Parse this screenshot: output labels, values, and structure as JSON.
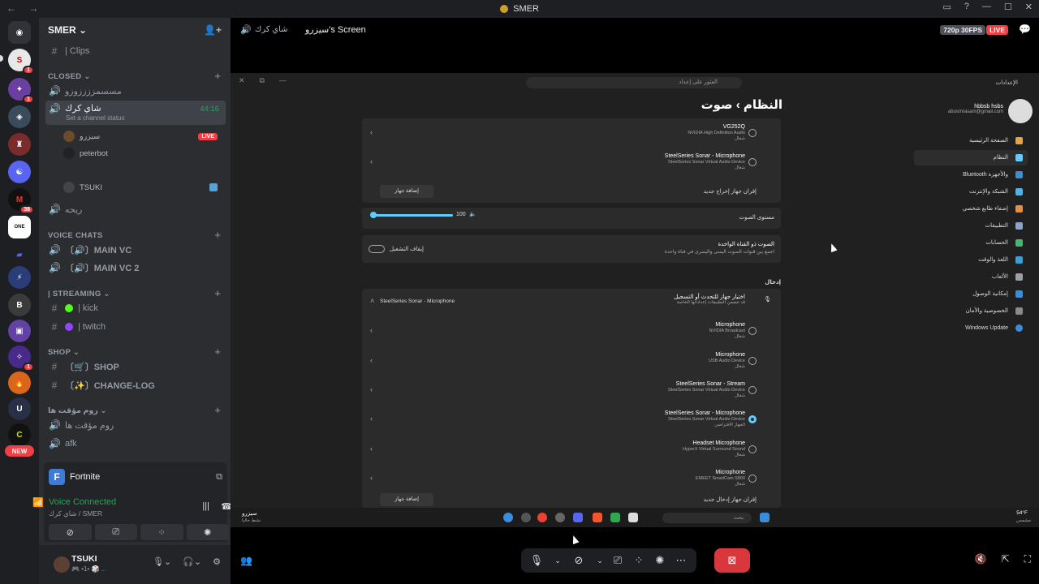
{
  "titlebar": {
    "title": "SMER",
    "nav": "← →",
    "icons": [
      "inbox-icon",
      "help-icon",
      "minimize-icon",
      "maximize-icon",
      "close-icon"
    ]
  },
  "server": {
    "name": "SMER",
    "chevron": "⌄"
  },
  "guild_badges": [
    "1",
    "1",
    "38",
    "1"
  ],
  "new_label": "NEW",
  "channels": {
    "clips": "| Clips",
    "cat_closed": "CLOSED",
    "closed_voice": "مسسمززززوزو",
    "active_voice": {
      "name": "شاي كرك",
      "timer": "44:16",
      "status": "Set a channel status"
    },
    "voice_users": [
      {
        "name": "سيزرو",
        "live": "LIVE"
      },
      {
        "name": "peterbot"
      },
      {
        "name": "TSUKI"
      }
    ],
    "other_voice": "ريحه",
    "cat_voice": "VOICE CHATS",
    "voice_chats": [
      "〔🔊〕MAIN VC",
      "〔🔊〕MAIN VC 2"
    ],
    "cat_streaming": "| STREAMING",
    "streaming": [
      "| kick",
      "| twitch"
    ],
    "cat_shop": "SHOP",
    "shop": [
      "〔🛒〕SHOP",
      "〔✨〕CHANGE-LOG"
    ],
    "cat_temp": "روم مؤقت ها",
    "temp": [
      "روم مؤقت ها",
      "afk"
    ]
  },
  "activity": {
    "game": "Fortnite",
    "icon": "F"
  },
  "voice": {
    "status": "Voice Connected",
    "location": "شاي كرك / SMER"
  },
  "user": {
    "name": "TSUKI",
    "status": "🎮 •1• 🎲 .."
  },
  "stage": {
    "channel": "شاي كرك",
    "screen_title": "سيزرو's Screen",
    "quality": "720p 30FPS",
    "live": "LIVE"
  },
  "settings": {
    "search_placeholder": "العثور على إعداد",
    "sidebar_title": "الإعدادات",
    "account_name": "hbbsb hsbs",
    "account_email": "abusmrasam@gmail.com",
    "breadcrumb": "النظام  ›  صوت",
    "nav": [
      "الصفحة الرئيسية",
      "النظام",
      "Bluetooth والأجهزة",
      "الشبكة والإنترنت",
      "إضفاء طابع شخصي",
      "التطبيقات",
      "الحسابات",
      "اللغة والوقت",
      "الألعاب",
      "إمكانية الوصول",
      "الخصوصية والأمان",
      "Windows Update"
    ],
    "out_devices": [
      {
        "name": "VG252Q",
        "sub": "NVIDIA High Definition Audio\nشغال"
      },
      {
        "name": "SteelSeries Sonar - Microphone",
        "sub": "SteelSeries Sonar Virtual Audio Device\nشغال"
      }
    ],
    "pair_label": "إقران جهاز إخراج جديد",
    "add_device": "إضافة جهاز",
    "volume_label": "مستوى الصوت",
    "volume_value": "100",
    "mono_title": "الصوت ذو القناة الواحدة",
    "mono_sub": "اجمع بين قنوات الصوت اليمنى واليسرى في قناة واحدة",
    "mono_toggle": "إيقاف التشغيل",
    "input_header": "إدخال",
    "input_choose_title": "اختيار جهاز للتحدث أو التسجيل",
    "input_choose_sub": "قد تتضمن التطبيقات إعداداتها الخاصة",
    "input_current": "SteelSeries Sonar - Microphone",
    "in_devices": [
      {
        "name": "Microphone",
        "sub": "NVIDIA Broadcast\nشغال",
        "selected": false
      },
      {
        "name": "Microphone",
        "sub": "USB Audio Device\nشغال",
        "selected": false
      },
      {
        "name": "SteelSeries Sonar - Stream",
        "sub": "SteelSeries Sonar Virtual Audio Device\nشغال",
        "selected": false
      },
      {
        "name": "SteelSeries Sonar - Microphone",
        "sub": "SteelSeries Sonar Virtual Audio Device\nالجهاز الافتراضي",
        "selected": true
      },
      {
        "name": "Headset Microphone",
        "sub": "HyperX Virtual Surround Sound\nشغال",
        "selected": false
      },
      {
        "name": "Microphone",
        "sub": "EMEET SmartCam S800\nشغال",
        "selected": false
      }
    ],
    "add_in_label": "إقران جهاز إدخال جديد",
    "taskbar_search": "بحث",
    "taskbar_weather": "54°F",
    "taskbar_weather_sub": "مشمس",
    "taskbar_user": "سيزرو",
    "taskbar_user_sub": "نشط حاليا"
  },
  "controls": [
    "mic-icon",
    "camera-off-icon",
    "screen-share-icon",
    "activities-icon",
    "soundboard-icon",
    "more-icon",
    "leave-call-icon"
  ]
}
